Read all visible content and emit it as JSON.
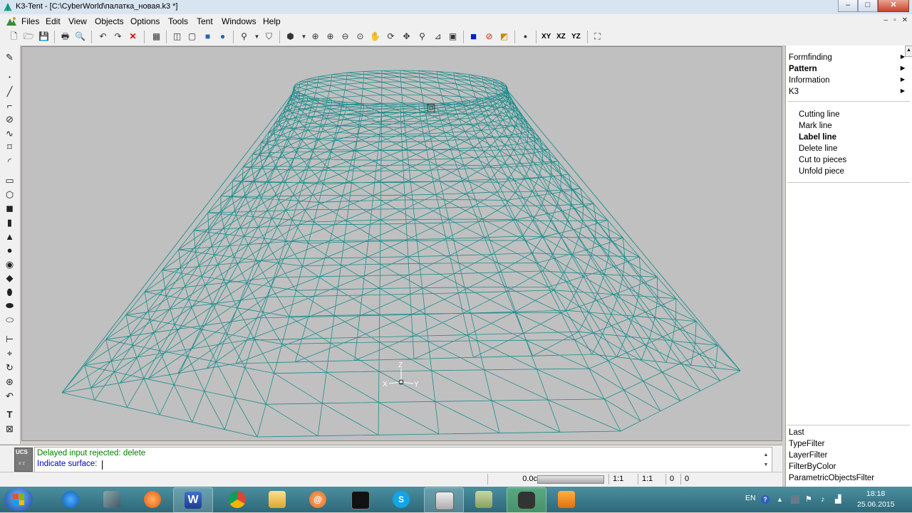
{
  "window": {
    "title": "K3-Tent - [C:\\CyberWorld\\палатка_новая.k3 *]",
    "minimize": "–",
    "maximize": "□",
    "close": "✕"
  },
  "menu": [
    "Files",
    "Edit",
    "View",
    "Objects",
    "Options",
    "Tools",
    "Tent",
    "Windows",
    "Help"
  ],
  "mdi_buttons": [
    "–",
    "▫",
    "✕"
  ],
  "toolbar_axis_labels": [
    "XY",
    "XZ",
    "YZ"
  ],
  "right_panel": {
    "menus": [
      {
        "label": "Formfinding",
        "bold": false
      },
      {
        "label": "Pattern",
        "bold": true
      },
      {
        "label": "Information",
        "bold": false
      },
      {
        "label": "K3",
        "bold": false
      }
    ],
    "arrow": "▶",
    "pattern_items": [
      {
        "label": "Cutting line",
        "bold": false
      },
      {
        "label": "Mark line",
        "bold": false
      },
      {
        "label": "Label line",
        "bold": true
      },
      {
        "label": "Delete line",
        "bold": false
      },
      {
        "label": "Cut to pieces",
        "bold": false
      },
      {
        "label": "Unfold piece",
        "bold": false
      }
    ],
    "filters": [
      "Last",
      "TypeFilter",
      "LayerFilter",
      "FilterByColor",
      "ParametricObjectsFilter"
    ]
  },
  "command": {
    "ucs_label": "UCS",
    "ucs_axes": "x z",
    "line1": "Delayed input rejected: delete",
    "line2": "Indicate surface:",
    "line1_color": "#008000",
    "line2_color": "#0000cc"
  },
  "status": {
    "value": "0.0c",
    "scale1": "1:1",
    "scale2": "1:1",
    "n1": "0",
    "n2": "0"
  },
  "viewport": {
    "axis_labels": {
      "z": "Z",
      "x": "X",
      "y": "Y"
    },
    "mesh_color": "#1e8c8c"
  },
  "taskbar": {
    "lang": "EN",
    "time": "18:18",
    "date": "25.06.2015",
    "help": "?"
  }
}
